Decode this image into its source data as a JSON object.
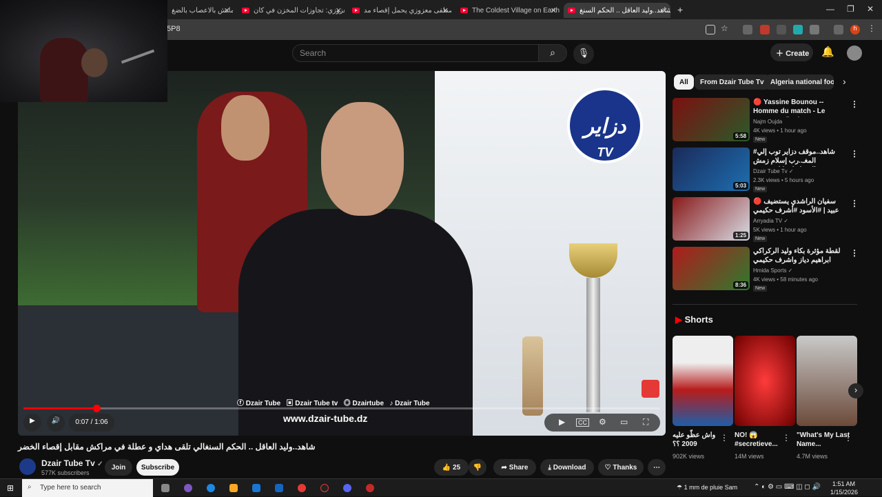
{
  "browser": {
    "tabs": [
      {
        "label": "ماتش بالاعصاب بالضغ"
      },
      {
        "label": "معزوزي: تجاوزات المخزن في كان"
      },
      {
        "label": "مصطفى معزوزي يحمل إقصاء مد"
      },
      {
        "label": "The Coldest Village on Earth: O"
      },
      {
        "label": "شاهد..وليد العاقل .. الحكم السنغ"
      }
    ],
    "new_tab": "+",
    "url_fragment": "5P8",
    "window_controls": [
      "—",
      "❐",
      "✕"
    ],
    "profile_initial": "h"
  },
  "header": {
    "search_placeholder": "Search",
    "create_label": "Create"
  },
  "video": {
    "overlay_logo": "دزاير",
    "overlay_logo_sub": "TV",
    "social": [
      "Dzair Tube",
      "Dzair Tube tv",
      "Dzairtube",
      "Dzair Tube"
    ],
    "site_url": "www.dzair-tube.dz",
    "time": "0:07 / 1:06",
    "progress_fraction": 0.115
  },
  "video_title": "شاهد..وليد العاقل .. الحكم السنغالي تلقى هداي و عطلة في مراكش مقابل إقصاء الخضر",
  "channel": {
    "name": "Dzair Tube Tv",
    "subscribers": "577K subscribers",
    "join": "Join",
    "subscribe": "Subscribe"
  },
  "actions": {
    "likes": "25",
    "share": "Share",
    "download": "Download",
    "thanks": "Thanks"
  },
  "chips": [
    "All",
    "From Dzair Tube Tv",
    "Algeria national footb"
  ],
  "recommendations": [
    {
      "title": "🔴 Yassine Bounou -- Homme du match - Le Maroc en final",
      "channel": "Najm Oujda",
      "meta": "4K views • 1 hour ago",
      "badge": "New",
      "duration": "5:58"
    },
    {
      "title": "#شاهد..موقف دزاير توب إلي المغـ..رب إسلام زمش ...\"المضايقات كانت تمس الصحافيين",
      "channel": "Dzair Tube Tv ✓",
      "meta": "2.3K views • 5 hours ago",
      "badge": "New",
      "duration": "5:03"
    },
    {
      "title": "🔴 سفيان الراشدي يستضيف عبيد | #الأسود #أشرف حكيمي",
      "channel": "Arryadia TV ✓",
      "meta": "5K views • 1 hour ago",
      "badge": "New",
      "duration": "1:25"
    },
    {
      "title": "لقطة مؤثرة بكاء وليد الركراكي ابراهيم دياز واشرف حكيمي",
      "channel": "Hmida Sports ✓",
      "meta": "4K views • 58 minutes ago",
      "badge": "New",
      "duration": "8:36"
    }
  ],
  "shorts": {
    "heading": "Shorts",
    "items": [
      {
        "title": "واش عظّو عليه 2009 ؟؟",
        "views": "902K views"
      },
      {
        "title": "NO! 😱 #secretieve...",
        "views": "14M views"
      },
      {
        "title": "\"What's My Last Name...",
        "views": "4.7M views"
      }
    ]
  },
  "taskbar": {
    "search_placeholder": "Type here to search",
    "weather": "1 mm de pluie Sam",
    "time": "1:51 AM",
    "date": "1/15/2026"
  },
  "colors": {
    "accent": "#ff0000",
    "bg": "#0f0f0f"
  }
}
